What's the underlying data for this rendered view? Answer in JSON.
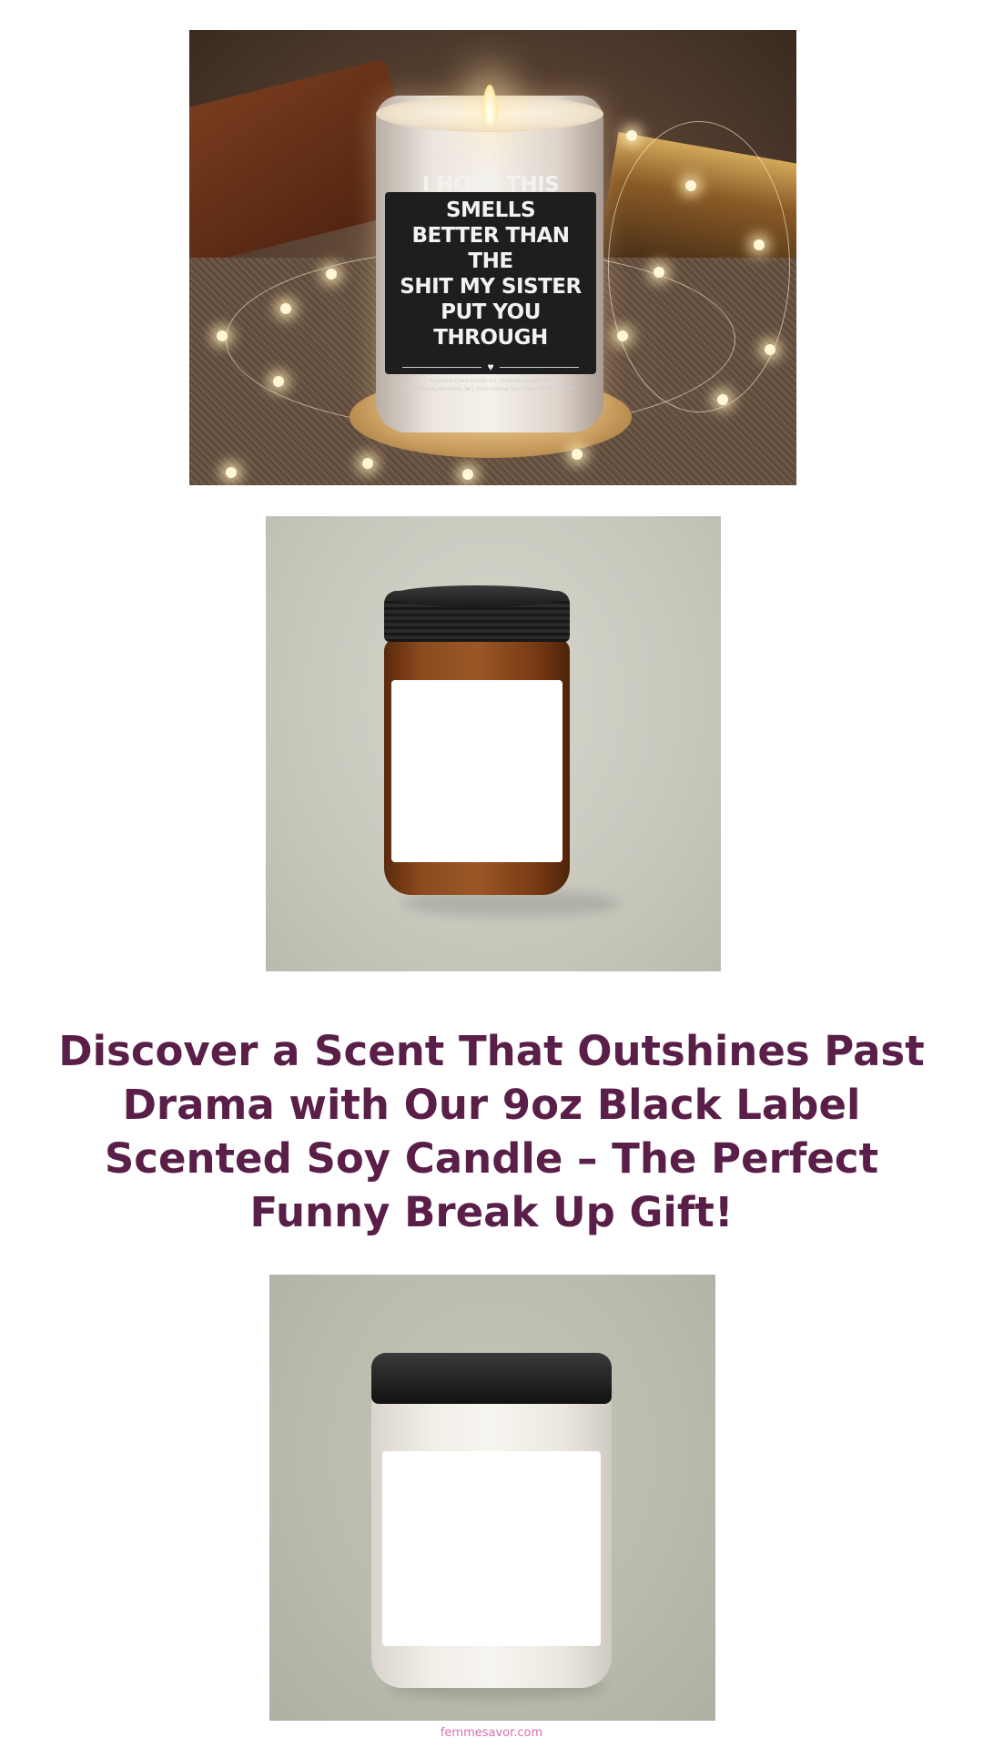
{
  "images": [
    {
      "label_text": "I HOPE THIS SMELLS\nBETTER THAN THE\nSHIT MY SISTER\nPUT YOU THROUGH",
      "label_fine": "Keystone Coast Candle Co. | KeystoneCoast.com\nEco-Friendly Reusable Jar | 100% Natural Soy | Cotton Wick | 50-60h"
    },
    {},
    {}
  ],
  "heading": "Discover a Scent That Outshines Past Drama with Our 9oz Black Label Scented Soy Candle – The Perfect Funny Break Up Gift!",
  "footer": {
    "link_text": "femmesavor.com"
  },
  "colors": {
    "heading": "#5a1f48",
    "footer_link": "#d96fb1",
    "background": "#ffffff"
  }
}
